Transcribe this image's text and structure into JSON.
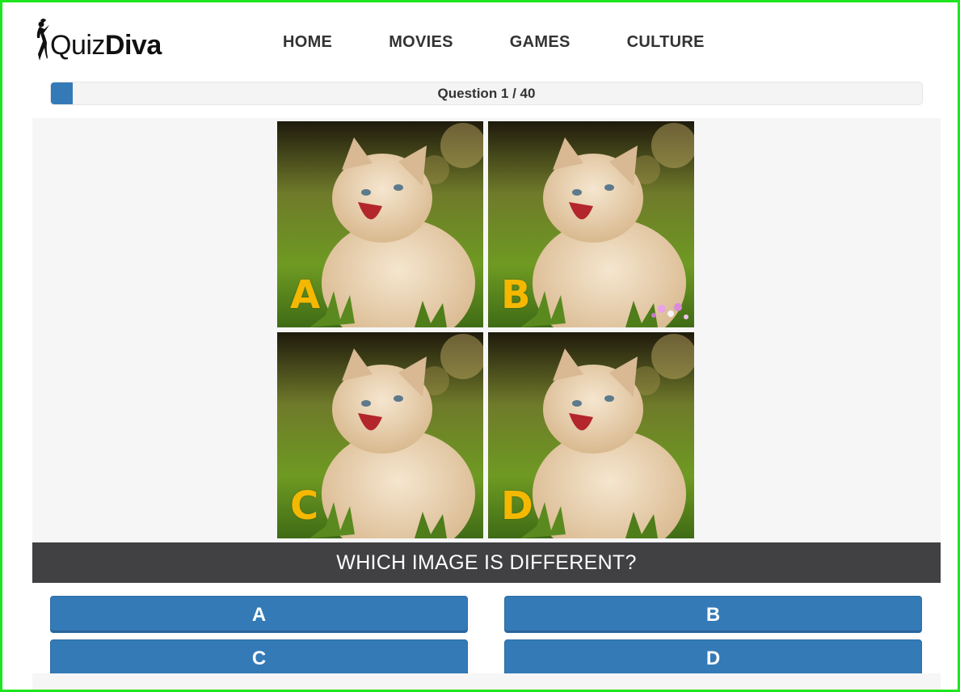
{
  "brand": {
    "name_light": "Quiz",
    "name_bold": "Diva"
  },
  "nav": {
    "items": [
      "HOME",
      "MOVIES",
      "GAMES",
      "CULTURE"
    ]
  },
  "progress": {
    "label": "Question 1 / 40",
    "current": 1,
    "total": 40,
    "fill_fraction": 0.025
  },
  "tiles": [
    {
      "letter": "A",
      "has_flowers": false
    },
    {
      "letter": "B",
      "has_flowers": true
    },
    {
      "letter": "C",
      "has_flowers": false
    },
    {
      "letter": "D",
      "has_flowers": false
    }
  ],
  "question": {
    "text": "WHICH IMAGE IS DIFFERENT?"
  },
  "answers": {
    "a": "A",
    "b": "B",
    "c": "C",
    "d": "D"
  },
  "colors": {
    "accent": "#337ab7",
    "frame_border": "#1ee61e",
    "question_bar": "#414042",
    "tile_letter": "#f5b800"
  }
}
